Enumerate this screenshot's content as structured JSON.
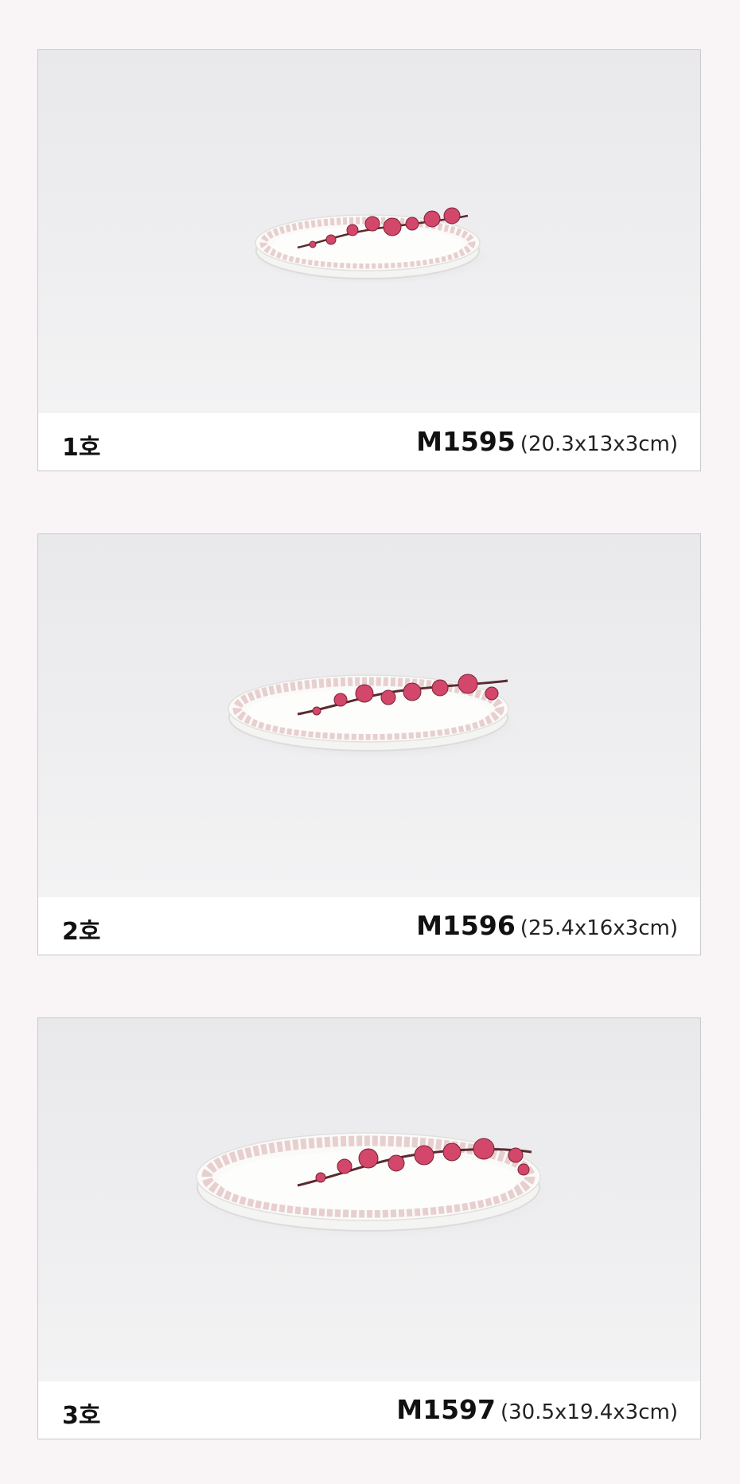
{
  "products": [
    {
      "size_label": "1호",
      "model": "M1595",
      "dimensions": "(20.3x13x3cm)",
      "image_icon": "oval-plate-small-image"
    },
    {
      "size_label": "2호",
      "model": "M1596",
      "dimensions": "(25.4x16x3cm)",
      "image_icon": "oval-plate-medium-image"
    },
    {
      "size_label": "3호",
      "model": "M1597",
      "dimensions": "(30.5x19.4x3cm)",
      "image_icon": "oval-plate-large-image"
    }
  ],
  "colors": {
    "page_background": "#f9f4f5",
    "photo_background": "#ececee",
    "blossom": "#d2476a",
    "rim_pattern": "#e3c9c9"
  }
}
